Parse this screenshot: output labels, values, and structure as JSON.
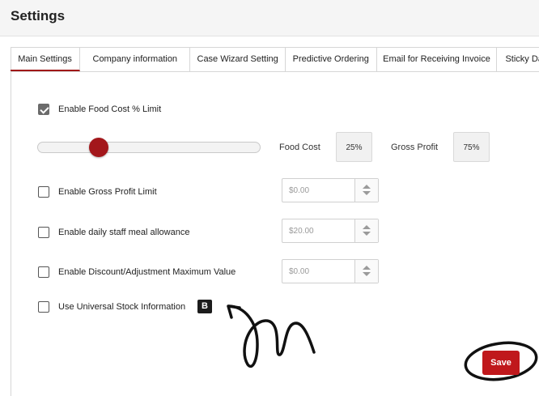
{
  "page": {
    "title": "Settings"
  },
  "tabs": [
    {
      "label": "Main Settings",
      "active": true
    },
    {
      "label": "Company information",
      "active": false
    },
    {
      "label": "Case Wizard Setting",
      "active": false
    },
    {
      "label": "Predictive Ordering",
      "active": false
    },
    {
      "label": "Email for Receiving Invoice",
      "active": false
    },
    {
      "label": "Sticky Da",
      "active": false
    }
  ],
  "food_cost": {
    "label": "Enable Food Cost % Limit",
    "checked": true,
    "slider_value_percent": 25,
    "food_cost_label": "Food Cost",
    "food_cost_value": "25%",
    "gross_profit_label": "Gross Profit",
    "gross_profit_value": "75%"
  },
  "options": [
    {
      "label": "Enable Gross Profit Limit",
      "checked": false,
      "placeholder": "$0.00"
    },
    {
      "label": "Enable daily staff meal allowance",
      "checked": false,
      "placeholder": "$20.00"
    },
    {
      "label": "Enable Discount/Adjustment Maximum Value",
      "checked": false,
      "placeholder": "$0.00"
    }
  ],
  "universal_stock": {
    "label": "Use Universal Stock Information",
    "checked": false,
    "badge": "B"
  },
  "actions": {
    "save_label": "Save"
  },
  "colors": {
    "accent": "#c0181c",
    "slider_thumb": "#a3171b",
    "annotation": "#111111"
  },
  "icons": {
    "stepper": "chevron-up-down-icon",
    "badge": "letter-b-badge-icon",
    "annotation": "hand-drawn-arrow-icon"
  }
}
